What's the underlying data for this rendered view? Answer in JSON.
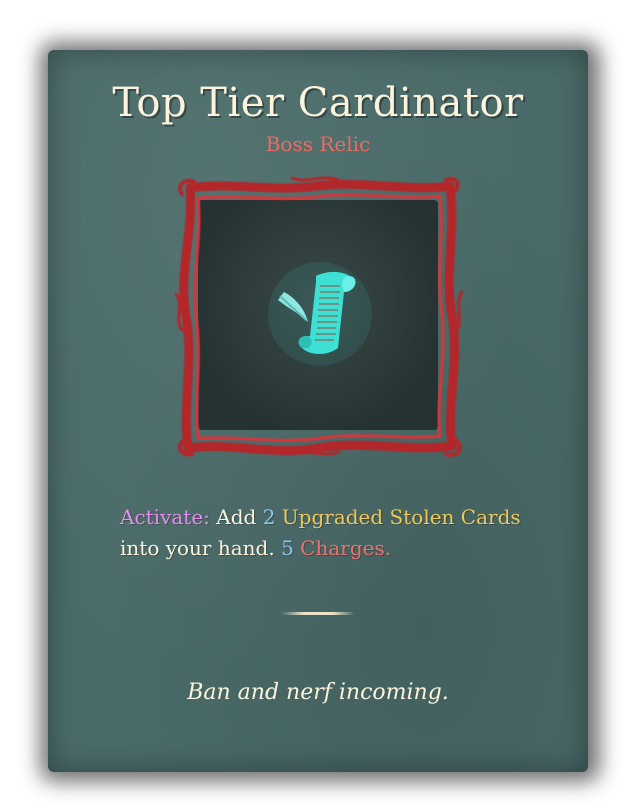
{
  "card": {
    "title": "Top Tier Cardinator",
    "rarity": "Boss Relic",
    "image_icon": "scroll-quill-icon",
    "description": {
      "activate": "Activate:",
      "add": "Add",
      "card_count": "2",
      "card_type": "Upgraded Stolen Cards",
      "into_hand": "into your hand.",
      "charge_count": "5",
      "charges": "Charges."
    },
    "flavor": "Ban and nerf incoming."
  },
  "colors": {
    "card_background": "#4a6b69",
    "title": "#fbf3dc",
    "rarity": "#ef6a62",
    "frame": "#b3252c",
    "keyword_activate": "#e58ef0",
    "keyword_number": "#8fc7ef",
    "keyword_gold": "#efc85a",
    "keyword_red": "#f07070",
    "relic_teal": "#3fe0d4"
  }
}
